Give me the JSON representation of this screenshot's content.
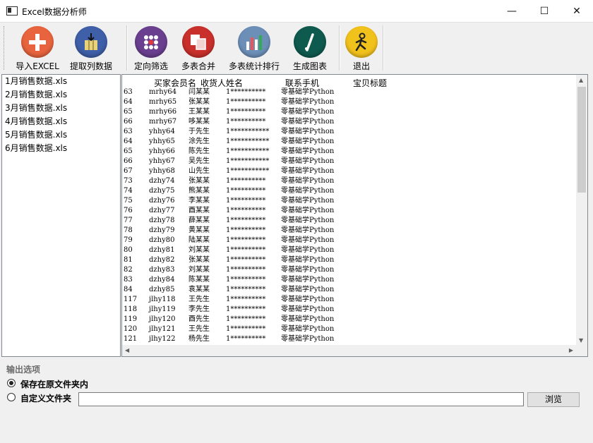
{
  "window": {
    "title": "Excel数据分析师",
    "minimize": "—",
    "maximize": "☐",
    "close": "✕"
  },
  "toolbar": [
    {
      "label": "导入EXCEL",
      "icon": "add-icon",
      "color": "#e8643e"
    },
    {
      "label": "提取列数据",
      "icon": "extract-column-icon",
      "color": "#3f5fa8"
    },
    {
      "label": "定向筛选",
      "icon": "filter-dots-icon",
      "color": "#6a3f8f"
    },
    {
      "label": "多表合并",
      "icon": "merge-tables-icon",
      "color": "#c9302c"
    },
    {
      "label": "多表统计排行",
      "icon": "bar-chart-icon",
      "color": "#6c8fb8"
    },
    {
      "label": "生成图表",
      "icon": "chart-pen-icon",
      "color": "#0f5a4f"
    },
    {
      "label": "退出",
      "icon": "exit-runner-icon",
      "color": "#f2c21c"
    }
  ],
  "files": [
    "1月销售数据.xls",
    "2月销售数据.xls",
    "3月销售数据.xls",
    "4月销售数据.xls",
    "5月销售数据.xls",
    "6月销售数据.xls"
  ],
  "table": {
    "headers": [
      "买家会员名",
      "收货人姓名",
      "联系手机",
      "宝贝标题"
    ],
    "rows": [
      [
        "63",
        "mrhy64",
        "闫某某",
        "1**********",
        "零基础学Python"
      ],
      [
        "64",
        "mrhy65",
        "张某某",
        "1**********",
        "零基础学Python"
      ],
      [
        "65",
        "mrhy66",
        "王某某",
        "1**********",
        "零基础学Python"
      ],
      [
        "66",
        "mrhy67",
        "哆某某",
        "1**********",
        "零基础学Python"
      ],
      [
        "63",
        "yhhy64",
        "于先生",
        "1***********",
        "零基础学Python"
      ],
      [
        "64",
        "yhhy65",
        "涂先生",
        "1***********",
        "零基础学Python"
      ],
      [
        "65",
        "yhhy66",
        "陈先生",
        "1***********",
        "零基础学Python"
      ],
      [
        "66",
        "yhhy67",
        "吴先生",
        "1***********",
        "零基础学Python"
      ],
      [
        "67",
        "yhhy68",
        "山先生",
        "1***********",
        "零基础学Python"
      ],
      [
        "73",
        "dzhy74",
        "张某某",
        "1**********",
        "零基础学Python"
      ],
      [
        "74",
        "dzhy75",
        "熊某某",
        "1**********",
        "零基础学Python"
      ],
      [
        "75",
        "dzhy76",
        "李某某",
        "1**********",
        "零基础学Python"
      ],
      [
        "76",
        "dzhy77",
        "酉某某",
        "1**********",
        "零基础学Python"
      ],
      [
        "77",
        "dzhy78",
        "薛某某",
        "1**********",
        "零基础学Python"
      ],
      [
        "78",
        "dzhy79",
        "黄某某",
        "1**********",
        "零基础学Python"
      ],
      [
        "79",
        "dzhy80",
        "陆某某",
        "1**********",
        "零基础学Python"
      ],
      [
        "80",
        "dzhy81",
        "刘某某",
        "1**********",
        "零基础学Python"
      ],
      [
        "81",
        "dzhy82",
        "张某某",
        "1**********",
        "零基础学Python"
      ],
      [
        "82",
        "dzhy83",
        "刘某某",
        "1**********",
        "零基础学Python"
      ],
      [
        "83",
        "dzhy84",
        "陈某某",
        "1**********",
        "零基础学Python"
      ],
      [
        "84",
        "dzhy85",
        "袁某某",
        "1**********",
        "零基础学Python"
      ],
      [
        "117",
        "jlhy118",
        "王先生",
        "1**********",
        "零基础学Python"
      ],
      [
        "118",
        "jlhy119",
        "李先生",
        "1**********",
        "零基础学Python"
      ],
      [
        "119",
        "jlhy120",
        "酉先生",
        "1**********",
        "零基础学Python"
      ],
      [
        "120",
        "jlhy121",
        "王先生",
        "1**********",
        "零基础学Python"
      ],
      [
        "121",
        "jlhy122",
        "杨先生",
        "1**********",
        "零基础学Python"
      ]
    ]
  },
  "output": {
    "section_title": "输出选项",
    "option_original": "保存在原文件夹内",
    "option_custom": "自定义文件夹",
    "path_value": "",
    "browse_label": "浏览"
  }
}
